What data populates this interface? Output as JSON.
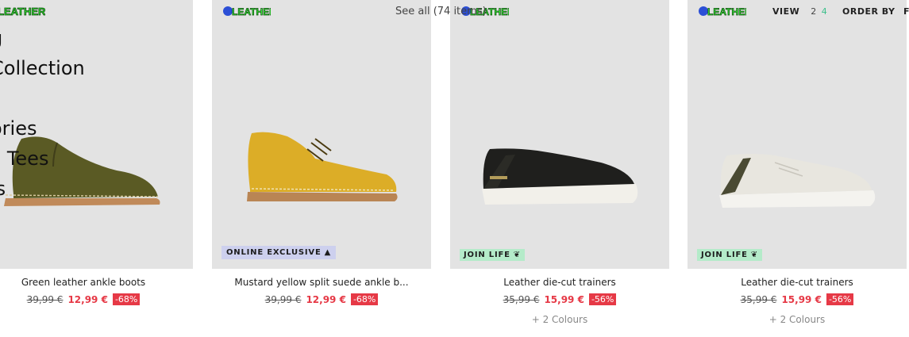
{
  "menu": {
    "items": [
      "g",
      "Collection",
      "",
      "ories",
      "c Tees",
      "ls"
    ]
  },
  "toolbar": {
    "see_all": "See all (74 items)",
    "view_label": "VIEW",
    "view_option_2": "2",
    "view_option_4": "4",
    "order_by": "ORDER BY",
    "filter_label": "F"
  },
  "colors": {
    "discount": "#e63946",
    "join_life": "#b4ebc9",
    "online_exclusive": "#cdd0ee",
    "image_bg": "#e3e3e3"
  },
  "products": [
    {
      "title": "Green leather ankle boots",
      "old_price": "39,99 €",
      "new_price": "12,99 €",
      "discount": "-68%",
      "badge": "",
      "colours": ""
    },
    {
      "title": "Mustard yellow split suede ankle b...",
      "old_price": "39,99 €",
      "new_price": "12,99 €",
      "discount": "-68%",
      "badge": "ONLINE EXCLUSIVE",
      "colours": ""
    },
    {
      "title": "Leather die-cut trainers",
      "old_price": "35,99 €",
      "new_price": "15,99 €",
      "discount": "-56%",
      "badge": "JOIN LIFE",
      "colours": "+ 2 Colours"
    },
    {
      "title": "Leather die-cut trainers",
      "old_price": "35,99 €",
      "new_price": "15,99 €",
      "discount": "-56%",
      "badge": "JOIN LIFE",
      "colours": "+ 2 Colours"
    }
  ]
}
